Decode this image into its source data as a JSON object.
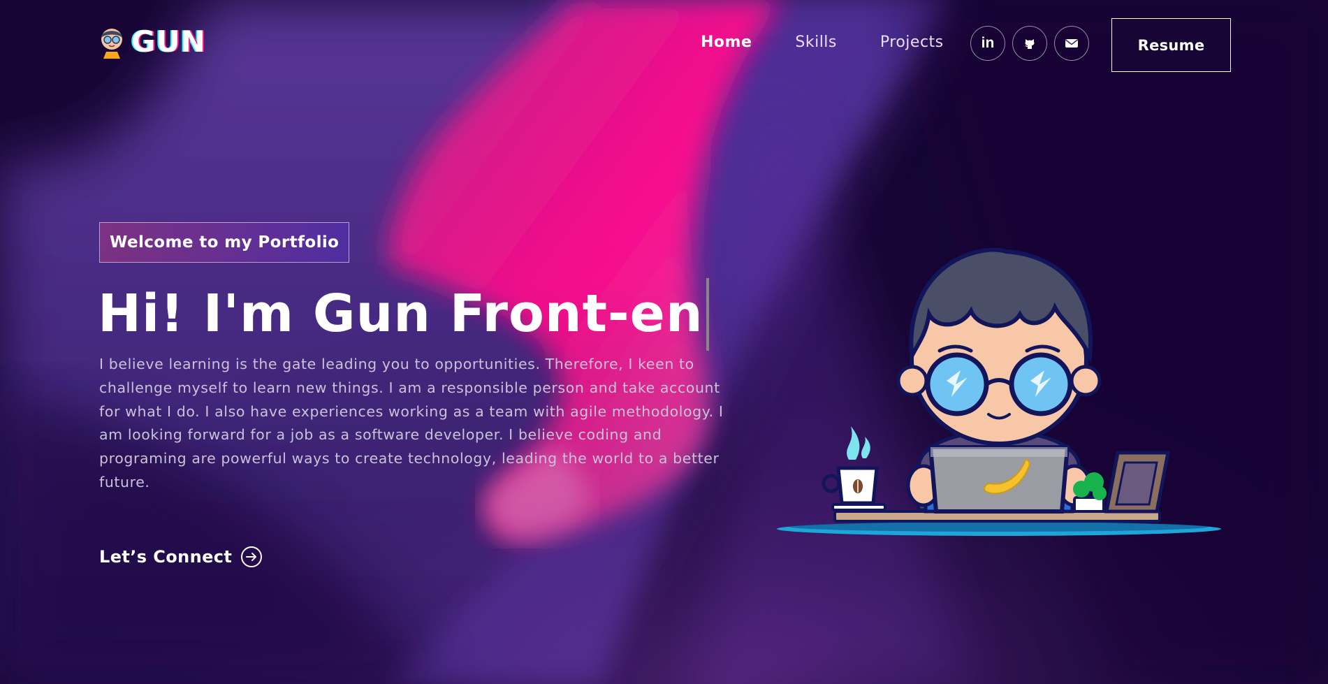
{
  "brand": {
    "name": "GUN",
    "logo_icon": "avatar-logo-icon"
  },
  "nav": {
    "links": [
      {
        "label": "Home"
      },
      {
        "label": "Skills"
      },
      {
        "label": "Projects"
      }
    ],
    "social": [
      {
        "icon": "linkedin-icon",
        "label": "in"
      },
      {
        "icon": "github-icon"
      },
      {
        "icon": "mail-icon"
      }
    ],
    "resume_label": "Resume"
  },
  "hero": {
    "badge": "Welcome to my Portfolio",
    "headline": "Hi! I'm Gun Front-en",
    "bio": "I believe learning is the gate leading you to opportunities. Therefore, I keen to challenge myself to learn new things. I am a responsible person and take account for what I do. I also have experiences working as a team with agile methodology. I am looking forward for a job as a software developer. I believe coding and programing are powerful ways to create technology, leading the world to a better future.",
    "cta_label": "Let’s Connect",
    "cta_icon": "arrow-right-circle-icon",
    "illustration_icon": "developer-at-laptop-illustration"
  },
  "colors": {
    "background": "#170635",
    "accent_pink": "#ff0a8c",
    "accent_purple": "#5b3fa3",
    "text_muted": "#c9c2d9"
  }
}
